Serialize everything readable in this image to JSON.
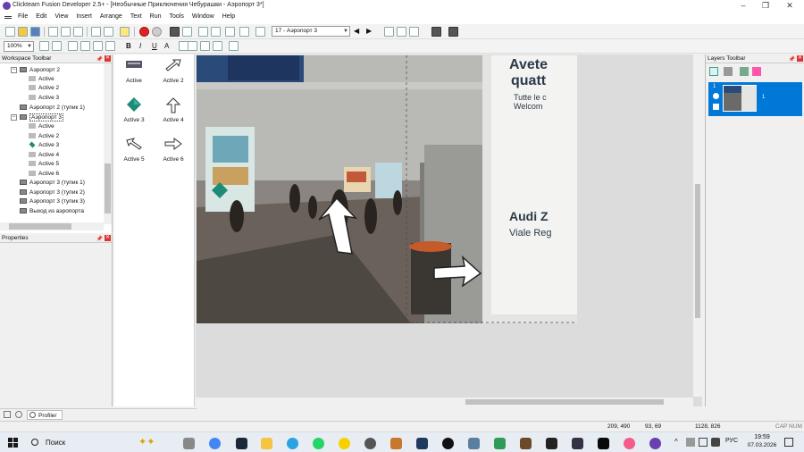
{
  "window": {
    "title": "Clickteam Fusion Developer 2.5+ - [Необычные Приключения Чебурашки - Аэропорт 3*]",
    "controls": [
      "–",
      "❐",
      "✕"
    ]
  },
  "menu": [
    "File",
    "Edit",
    "View",
    "Insert",
    "Arrange",
    "Text",
    "Run",
    "Tools",
    "Window",
    "Help"
  ],
  "toolbar": {
    "frame_select": "17 - Аэропорт 3",
    "zoom": "100%"
  },
  "workspace": {
    "title": "Workspace Toolbar",
    "items": [
      {
        "label": "Аэропорт 2",
        "type": "frame",
        "expanded": true
      },
      {
        "label": "Active",
        "type": "obj"
      },
      {
        "label": "Active 2",
        "type": "obj"
      },
      {
        "label": "Active 3",
        "type": "obj"
      },
      {
        "label": "Аэропорт 2 (тупик 1)",
        "type": "frame"
      },
      {
        "label": "Аэропорт 3",
        "type": "frame",
        "expanded": true,
        "selected": true
      },
      {
        "label": "Active",
        "type": "obj"
      },
      {
        "label": "Active 2",
        "type": "obj"
      },
      {
        "label": "Active 3",
        "type": "diamond"
      },
      {
        "label": "Active 4",
        "type": "obj"
      },
      {
        "label": "Active 5",
        "type": "obj"
      },
      {
        "label": "Active 6",
        "type": "obj"
      },
      {
        "label": "Аэропорт 3 (тупик 1)",
        "type": "frame"
      },
      {
        "label": "Аэропорт 3 (тупик 2)",
        "type": "frame"
      },
      {
        "label": "Аэропорт 3 (тупик 3)",
        "type": "frame"
      },
      {
        "label": "Выход из аэропорта",
        "type": "frame"
      }
    ]
  },
  "properties": {
    "title": "Properties"
  },
  "objects": [
    "Active",
    "Active 2",
    "Active 3",
    "Active 4",
    "Active 5",
    "Active 6"
  ],
  "scene": {
    "sign_text": [
      "Avete",
      "quatt",
      "Tutte le c",
      "Welcom",
      "Audi Z",
      "Viale Reg"
    ]
  },
  "layers": {
    "title": "Layers Toolbar",
    "layer_number": "1",
    "layer_name": "1"
  },
  "bottom_tabs": {
    "profiler": "Profiler"
  },
  "status": {
    "coords": "209, 490",
    "size": "93, 69",
    "frame_size": "1128, 826",
    "flags": "CAP NUM"
  },
  "taskbar": {
    "search_placeholder": "Поиск",
    "lang": "РУС",
    "time": "19:59",
    "date": "07.03.2026"
  },
  "colors": {
    "selection": "#0078d7",
    "accent_purple": "#6a3fb0",
    "teal_diamond": "#1f8a78"
  }
}
